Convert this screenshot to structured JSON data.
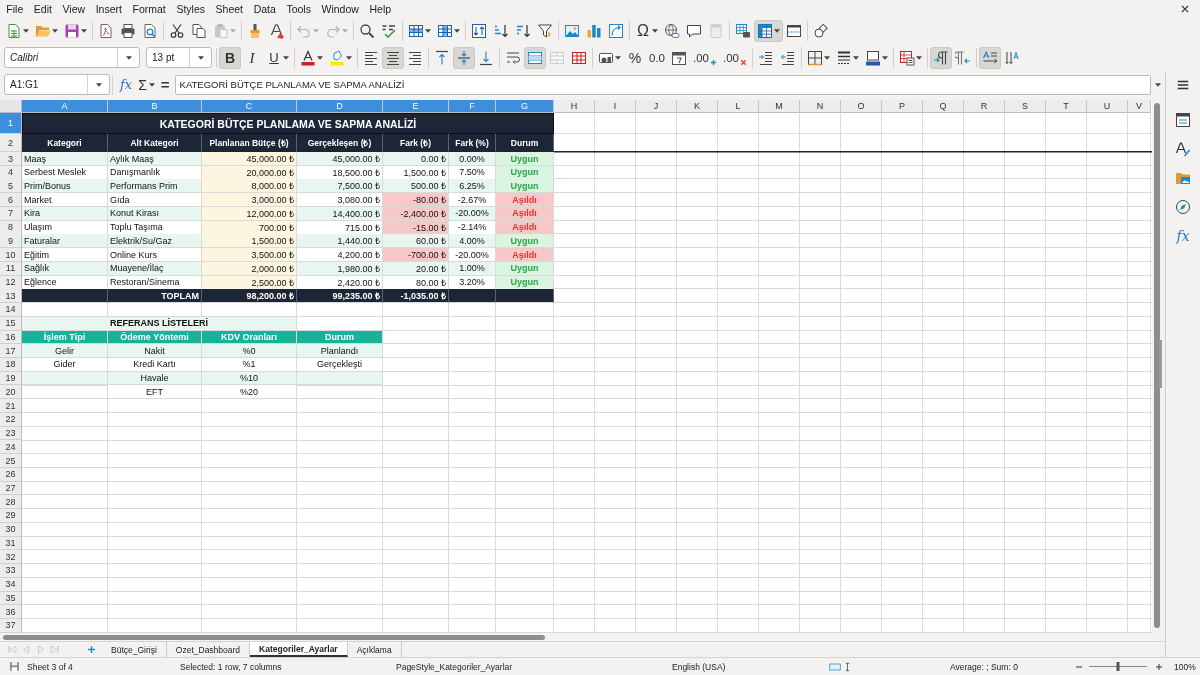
{
  "menu_bar": {
    "items": [
      "File",
      "Edit",
      "View",
      "Insert",
      "Format",
      "Styles",
      "Sheet",
      "Data",
      "Tools",
      "Window",
      "Help"
    ]
  },
  "standard_toolbar": {
    "paste": {
      "disabled": true
    },
    "undo": {
      "disabled": true
    },
    "redo": {
      "disabled": true
    },
    "special_character": "Ω",
    "header_footer": {
      "disabled": true
    },
    "freeze_rows_and_columns": {
      "pressed": true
    }
  },
  "formatting_toolbar": {
    "font_name": "Calibri",
    "font_size": "13 pt",
    "bold": {
      "glyph": "B",
      "pressed": true
    },
    "italic": {
      "glyph": "I",
      "pressed": false
    },
    "underline": {
      "glyph": "U",
      "pressed": false
    },
    "align_left": {
      "pressed": false
    },
    "align_center": {
      "pressed": true
    },
    "align_right": {
      "pressed": false
    },
    "align_top": {
      "pressed": false
    },
    "center_vertically": {
      "pressed": true
    },
    "align_bottom": {
      "pressed": false
    },
    "wrap_text": {
      "pressed": false
    },
    "merge_and_center": {
      "pressed": true
    },
    "merge_cells": {
      "disabled": true
    },
    "percent_format": "%",
    "number_format": "0.0",
    "add_decimal_place": ".00",
    "delete_decimal_place": ".00",
    "left_to_right": {
      "pressed": true
    },
    "right_to_left": {
      "pressed": false
    },
    "text_left_to_right": {
      "pressed": true
    },
    "text_top_to_bottom": {
      "pressed": false
    }
  },
  "formula_bar": {
    "name_box": "A1:G1",
    "function_wizard": "fx",
    "sum": "Σ",
    "formula": "=",
    "content": "KATEGORİ BÜTÇE PLANLAMA VE SAPMA ANALİZİ"
  },
  "sidebar": {
    "functions": "fx"
  },
  "sheet": {
    "column_headers": [
      {
        "label": "A",
        "selected": true
      },
      {
        "label": "B",
        "selected": true
      },
      {
        "label": "C",
        "selected": true
      },
      {
        "label": "D",
        "selected": true
      },
      {
        "label": "E",
        "selected": true
      },
      {
        "label": "F",
        "selected": true
      },
      {
        "label": "G",
        "selected": true
      },
      {
        "label": "H",
        "selected": false
      },
      {
        "label": "I",
        "selected": false
      },
      {
        "label": "J",
        "selected": false
      },
      {
        "label": "K",
        "selected": false
      },
      {
        "label": "L",
        "selected": false
      },
      {
        "label": "M",
        "selected": false
      },
      {
        "label": "N",
        "selected": false
      },
      {
        "label": "O",
        "selected": false
      },
      {
        "label": "P",
        "selected": false
      },
      {
        "label": "Q",
        "selected": false
      },
      {
        "label": "R",
        "selected": false
      },
      {
        "label": "S",
        "selected": false
      },
      {
        "label": "T",
        "selected": false
      },
      {
        "label": "U",
        "selected": false
      },
      {
        "label": "V",
        "selected": false
      }
    ],
    "row_headers": [
      {
        "label": "1",
        "selected": true
      },
      {
        "label": "2",
        "selected": false
      },
      {
        "label": "3",
        "selected": false
      },
      {
        "label": "4",
        "selected": false
      },
      {
        "label": "5",
        "selected": false
      },
      {
        "label": "6",
        "selected": false
      },
      {
        "label": "7",
        "selected": false
      },
      {
        "label": "8",
        "selected": false
      },
      {
        "label": "9",
        "selected": false
      },
      {
        "label": "10",
        "selected": false
      },
      {
        "label": "11",
        "selected": false
      },
      {
        "label": "12",
        "selected": false
      },
      {
        "label": "13",
        "selected": false
      },
      {
        "label": "14",
        "selected": false
      },
      {
        "label": "15",
        "selected": false
      },
      {
        "label": "16",
        "selected": false
      },
      {
        "label": "17",
        "selected": false
      },
      {
        "label": "18",
        "selected": false
      },
      {
        "label": "19",
        "selected": false
      },
      {
        "label": "20",
        "selected": false
      },
      {
        "label": "21",
        "selected": false
      },
      {
        "label": "22",
        "selected": false
      },
      {
        "label": "23",
        "selected": false
      },
      {
        "label": "24",
        "selected": false
      },
      {
        "label": "25",
        "selected": false
      },
      {
        "label": "26",
        "selected": false
      },
      {
        "label": "27",
        "selected": false
      },
      {
        "label": "28",
        "selected": false
      },
      {
        "label": "29",
        "selected": false
      },
      {
        "label": "30",
        "selected": false
      },
      {
        "label": "31",
        "selected": false
      },
      {
        "label": "32",
        "selected": false
      },
      {
        "label": "33",
        "selected": false
      },
      {
        "label": "34",
        "selected": false
      },
      {
        "label": "35",
        "selected": false
      },
      {
        "label": "36",
        "selected": false
      },
      {
        "label": "37",
        "selected": false
      }
    ],
    "title": "KATEGORİ BÜTÇE PLANLAMA VE SAPMA ANALİZİ",
    "budget_table": {
      "columns": [
        "Kategori",
        "Alt Kategori",
        "Planlanan Bütçe (₺)",
        "Gerçekleşen (₺)",
        "Fark (₺)",
        "Fark (%)",
        "Durum"
      ],
      "rows": [
        {
          "category": "Maaş",
          "subcategory": "Aylık Maaş",
          "planned": "45,000.00 ₺",
          "actual": "45,000.00 ₺",
          "difference": "0.00 ₺",
          "difference_percent": "0.00%",
          "status": "Uygun",
          "over_budget": false
        },
        {
          "category": "Serbest Meslek",
          "subcategory": "Danışmanlık",
          "planned": "20,000.00 ₺",
          "actual": "18,500.00 ₺",
          "difference": "1,500.00 ₺",
          "difference_percent": "7.50%",
          "status": "Uygun",
          "over_budget": false
        },
        {
          "category": "Prim/Bonus",
          "subcategory": "Performans Prim",
          "planned": "8,000.00 ₺",
          "actual": "7,500.00 ₺",
          "difference": "500.00 ₺",
          "difference_percent": "6.25%",
          "status": "Uygun",
          "over_budget": false
        },
        {
          "category": "Market",
          "subcategory": "Gıda",
          "planned": "3,000.00 ₺",
          "actual": "3,080.00 ₺",
          "difference": "-80.00 ₺",
          "difference_percent": "-2.67%",
          "status": "Aşıldı",
          "over_budget": true
        },
        {
          "category": "Kira",
          "subcategory": "Konut Kirası",
          "planned": "12,000.00 ₺",
          "actual": "14,400.00 ₺",
          "difference": "-2,400.00 ₺",
          "difference_percent": "-20.00%",
          "status": "Aşıldı",
          "over_budget": true
        },
        {
          "category": "Ulaşım",
          "subcategory": "Toplu Taşıma",
          "planned": "700.00 ₺",
          "actual": "715.00 ₺",
          "difference": "-15.00 ₺",
          "difference_percent": "-2.14%",
          "status": "Aşıldı",
          "over_budget": true
        },
        {
          "category": "Faturalar",
          "subcategory": "Elektrik/Su/Gaz",
          "planned": "1,500.00 ₺",
          "actual": "1,440.00 ₺",
          "difference": "60.00 ₺",
          "difference_percent": "4.00%",
          "status": "Uygun",
          "over_budget": false
        },
        {
          "category": "Eğitim",
          "subcategory": "Online Kurs",
          "planned": "3,500.00 ₺",
          "actual": "4,200.00 ₺",
          "difference": "-700.00 ₺",
          "difference_percent": "-20.00%",
          "status": "Aşıldı",
          "over_budget": true
        },
        {
          "category": "Sağlık",
          "subcategory": "Muayene/İlaç",
          "planned": "2,000.00 ₺",
          "actual": "1,980.00 ₺",
          "difference": "20.00 ₺",
          "difference_percent": "1.00%",
          "status": "Uygun",
          "over_budget": false
        },
        {
          "category": "Eğlence",
          "subcategory": "Restoran/Sinema",
          "planned": "2,500.00 ₺",
          "actual": "2,420.00 ₺",
          "difference": "80.00 ₺",
          "difference_percent": "3.20%",
          "status": "Uygun",
          "over_budget": false
        }
      ],
      "total": {
        "label": "TOPLAM",
        "planned": "98,200.00 ₺",
        "actual": "99,235.00 ₺",
        "difference": "-1,035.00 ₺"
      }
    },
    "reference_lists": {
      "title": "REFERANS LİSTELERİ",
      "columns": [
        {
          "header": "İşlem Tipi",
          "items": [
            "Gelir",
            "Gider"
          ]
        },
        {
          "header": "Ödeme Yöntemi",
          "items": [
            "Nakit",
            "Kredi Kartı",
            "Havale",
            "EFT"
          ]
        },
        {
          "header": "KDV Oranları",
          "items": [
            "%0",
            "%1",
            "%10",
            "%20"
          ]
        },
        {
          "header": "Durum",
          "items": [
            "Planlandı",
            "Gerçekleşti"
          ]
        }
      ]
    }
  },
  "sheet_tab_bar": {
    "navigation": {
      "disabled": true
    },
    "tabs": [
      {
        "label": "Bütçe_Girişi",
        "selected": false
      },
      {
        "label": "Ozet_Dashboard",
        "selected": false
      },
      {
        "label": "Kategoriler_Ayarlar",
        "selected": true
      },
      {
        "label": "Açıklama",
        "selected": false
      }
    ]
  },
  "status_bar": {
    "sheet_position": "Sheet 3 of 4",
    "selection": "Selected: 1 row, 7 columns",
    "page_style": "PageStyle_Kategoriler_Ayarlar",
    "language": "English (USA)",
    "summary": "Average: ; Sum: 0",
    "zoom_slider": {
      "level": 0.5
    },
    "zoom": "100%"
  }
}
